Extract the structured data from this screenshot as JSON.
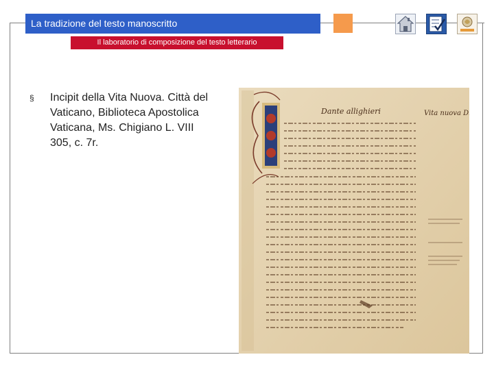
{
  "header": {
    "title": "La tradizione del testo manoscritto",
    "subtitle": "Il laboratorio di composizione del testo letterario"
  },
  "nav": {
    "home_icon": "home-icon",
    "check_icon": "checklist-icon",
    "logo_icon": "logo-icon"
  },
  "colors": {
    "title_bg": "#2e5fc8",
    "subtitle_bg": "#c8102e",
    "orange_box": "#f59a4c",
    "parchment": "#e7d6b4"
  },
  "content": {
    "bullet_marker": "§",
    "bullet_text": "Incipit della Vita Nuova. Città del Vaticano, Biblioteca Apostolica Vaticana, Ms. Chigiano L. VIII 305, c. 7r."
  },
  "image": {
    "header_text": "Dante allighieri",
    "margin_note": "Vita nuova D."
  }
}
